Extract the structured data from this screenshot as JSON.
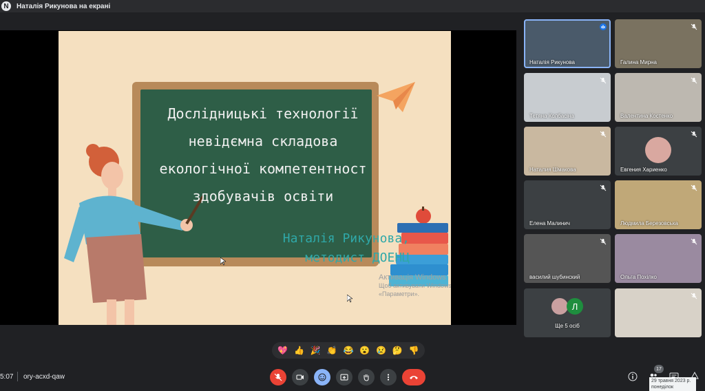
{
  "topbar": {
    "presenting": "Наталія Рикунова на екрані",
    "logo_letter": "N"
  },
  "slide": {
    "title_lines": [
      "Дослідницькі технології",
      "невідємна складова",
      "екологічної компетентност",
      "здобувачів освіти"
    ],
    "author_lines": [
      "Наталія Рикунова,",
      "методист ДОЕНЦ"
    ],
    "watermark_title": "Активація Windows",
    "watermark_text": "Щоб активувати Windows, перейдіть в розділ «Параметри»."
  },
  "participants": [
    {
      "name": "Наталія Рикунова",
      "muted": false,
      "speaking": true,
      "bg": "#4a5a6a"
    },
    {
      "name": "Галина Мирна",
      "muted": true,
      "speaking": false,
      "bg": "#7a7260"
    },
    {
      "name": "Тетяна Колбасіна",
      "muted": true,
      "speaking": false,
      "bg": "#c8ccd0"
    },
    {
      "name": "Валентина Костенко",
      "muted": true,
      "speaking": false,
      "bg": "#bdb8b0"
    },
    {
      "name": "Наталия Шмакова",
      "muted": true,
      "speaking": false,
      "bg": "#c9b8a0"
    },
    {
      "name": "Евгения Хариенко",
      "muted": true,
      "speaking": false,
      "bg": "#3c4043",
      "avatar": true
    },
    {
      "name": "Елена Малинич",
      "muted": true,
      "speaking": false,
      "bg": "#3c4043"
    },
    {
      "name": "Людмила Березовська",
      "muted": true,
      "speaking": false,
      "bg": "#c0a878"
    },
    {
      "name": "василий шубинский",
      "muted": true,
      "speaking": false,
      "bg": "#555555"
    },
    {
      "name": "Ольга Похілко",
      "muted": true,
      "speaking": false,
      "bg": "#9a8aa0"
    },
    {
      "name": "Ще 5 осіб",
      "muted": false,
      "speaking": false,
      "bg": "#3c4043",
      "more_letter": "Л"
    },
    {
      "name": "",
      "muted": true,
      "speaking": false,
      "bg": "#d8d2c8"
    }
  ],
  "reactions": [
    "💖",
    "👍",
    "🎉",
    "👏",
    "😂",
    "😮",
    "😢",
    "🤔",
    "👎"
  ],
  "bottom": {
    "clock": "5:07",
    "meeting_code": "ory-acxd-qaw",
    "participant_count": "17",
    "tooltip_date": "29 травня 2023 р.",
    "tooltip_day": "понеділок"
  },
  "colors": {
    "end_call": "#ea4335",
    "mic_off": "#ea4335",
    "emoji_active": "#8ab4f8",
    "board": "#2e5e47",
    "author_text": "#2fa8a8"
  }
}
